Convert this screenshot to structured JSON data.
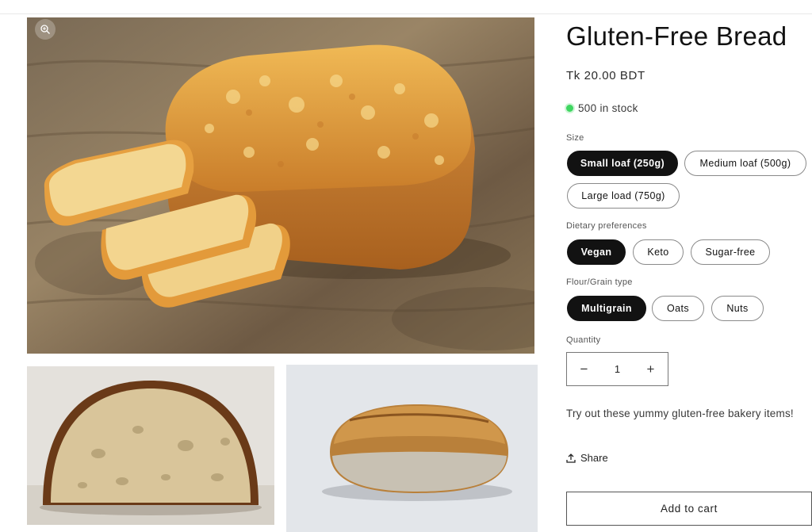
{
  "product": {
    "title": "Gluten-Free Bread",
    "price": "Tk 20.00 BDT",
    "stock_text": "500 in stock",
    "stock_color": "#3ed660",
    "description": "Try out these yummy gluten-free bakery items!"
  },
  "options": {
    "size": {
      "label": "Size",
      "items": [
        "Small loaf (250g)",
        "Medium loaf (500g)",
        "Large load (750g)"
      ],
      "selected": "Small loaf (250g)"
    },
    "dietary": {
      "label": "Dietary preferences",
      "items": [
        "Vegan",
        "Keto",
        "Sugar-free"
      ],
      "selected": "Vegan"
    },
    "flour": {
      "label": "Flour/Grain type",
      "items": [
        "Multigrain",
        "Oats",
        "Nuts"
      ],
      "selected": "Multigrain"
    }
  },
  "quantity": {
    "label": "Quantity",
    "value": "1",
    "minus": "−",
    "plus": "+"
  },
  "actions": {
    "share": "Share",
    "add_to_cart": "Add to cart"
  },
  "gallery": {
    "images": [
      "gluten-free-loaf-with-slices",
      "sourdough-half-loaf",
      "rustic-bread-loaf"
    ],
    "zoom_icon": "zoom-in-icon"
  },
  "colors": {
    "accent": "#121212",
    "selected_pill_text": "#ffffff"
  }
}
